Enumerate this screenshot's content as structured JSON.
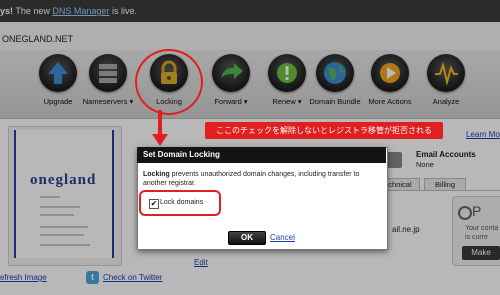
{
  "topbar": {
    "prefix": "ys!",
    "text": "The new",
    "link": "DNS Manager",
    "suffix": "is live."
  },
  "domain": {
    "name": "ONEGLAND.NET"
  },
  "toolbar": {
    "items": [
      {
        "label": "Upgrade",
        "icon": "upgrade-icon"
      },
      {
        "label": "Nameservers ▾",
        "icon": "nameservers-icon"
      },
      {
        "label": "Locking",
        "icon": "lock-icon"
      },
      {
        "label": "Forward ▾",
        "icon": "forward-icon"
      },
      {
        "label": "Renew ▾",
        "icon": "renew-icon"
      },
      {
        "label": "Domain Bundle",
        "icon": "globe-icon"
      },
      {
        "label": "More Actions",
        "icon": "more-actions-icon"
      },
      {
        "label": "Analyze",
        "icon": "analyze-icon"
      }
    ]
  },
  "preview": {
    "logo": "onegland",
    "refresh_link": "efresh Image",
    "twitter_link": "Check on Twitter"
  },
  "background": {
    "learn_more": "Learn Mo",
    "email_title": "Email Accounts",
    "email_value": "None",
    "tab_technical": "Technical",
    "tab_billing": "Billing",
    "email_fragment": "ail.ne.jp",
    "edit_link": "Edit",
    "promo_letter": "P",
    "promo_line1": "Your conta",
    "promo_line2": "is curre",
    "promo_button": "Make"
  },
  "dialog": {
    "title": "Set Domain Locking",
    "desc_bold": "Locking",
    "desc_rest": " prevents unauthorized domain changes, including transfer to another registrar.",
    "checkbox_label": "Lock domains",
    "checkbox_checked": true,
    "ok": "OK",
    "cancel": "Cancel"
  },
  "annotation": {
    "callout": "ここのチェックを解除しないとレジストラ移管が拒否される",
    "color": "#e02020"
  }
}
